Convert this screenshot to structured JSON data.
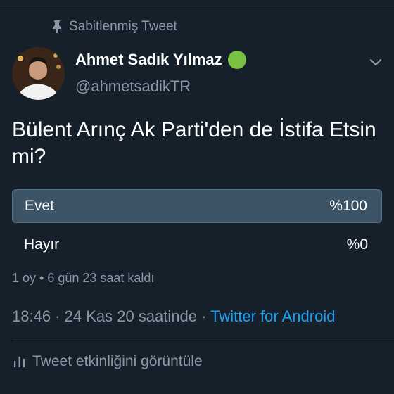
{
  "pinned": {
    "label": "Sabitlenmiş Tweet",
    "icon": "pin-icon"
  },
  "author": {
    "name": "Ahmet Sadık Yılmaz",
    "handle": "@ahmetsadikTR",
    "avatar_icon": "avatar",
    "status_icon": "green-circle-icon",
    "status_color": "#7ac143"
  },
  "tweet": {
    "question": "Bülent Arınç Ak Parti'den de İstifa Etsin mi?",
    "poll": {
      "options": [
        {
          "label": "Evet",
          "percent": "%100",
          "value": 100
        },
        {
          "label": "Hayır",
          "percent": "%0",
          "value": 0
        }
      ],
      "summary": "1 oy • 6 gün 23 saat kaldı"
    },
    "timestamp": "18:46 · 24 Kas 20 saatinde · ",
    "source": "Twitter for Android"
  },
  "activity": {
    "label": "Tweet etkinliğini görüntüle",
    "icon": "bar-chart-icon"
  },
  "colors": {
    "background": "#15202b",
    "secondary_text": "#8899a6",
    "link": "#1da1f2",
    "poll_fill": "#3d5466"
  }
}
